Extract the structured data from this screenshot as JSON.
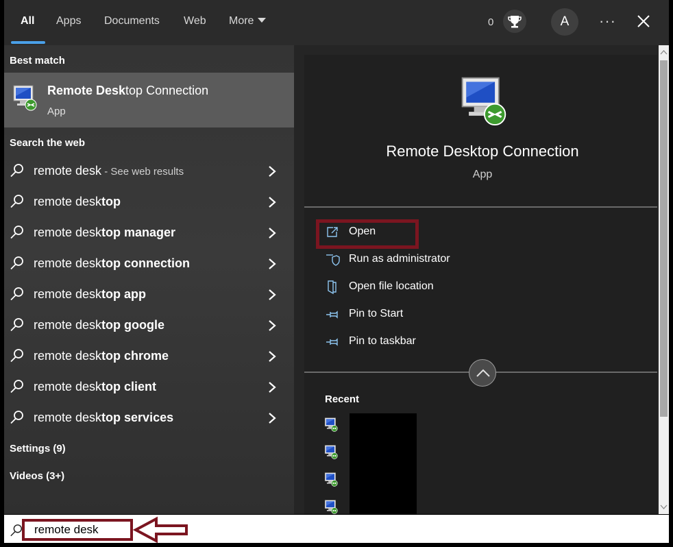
{
  "tabs": [
    {
      "label": "All"
    },
    {
      "label": "Apps"
    },
    {
      "label": "Documents"
    },
    {
      "label": "Web"
    },
    {
      "label": "More"
    }
  ],
  "header": {
    "points": "0",
    "avatar_initial": "A",
    "more_options": "···"
  },
  "left": {
    "best_match_heading": "Best match",
    "best_match": {
      "title_bold": "Remote Desk",
      "title_rest": "top Connection",
      "type": "App"
    },
    "search_web_heading": "Search the web",
    "suggestions": [
      {
        "prefix": "remote desk",
        "bold": "",
        "hint": " - See web results"
      },
      {
        "prefix": "remote desk",
        "bold": "top",
        "hint": ""
      },
      {
        "prefix": "remote desk",
        "bold": "top manager",
        "hint": ""
      },
      {
        "prefix": "remote desk",
        "bold": "top connection",
        "hint": ""
      },
      {
        "prefix": "remote desk",
        "bold": "top app",
        "hint": ""
      },
      {
        "prefix": "remote desk",
        "bold": "top google",
        "hint": ""
      },
      {
        "prefix": "remote desk",
        "bold": "top chrome",
        "hint": ""
      },
      {
        "prefix": "remote desk",
        "bold": "top client",
        "hint": ""
      },
      {
        "prefix": "remote desk",
        "bold": "top services",
        "hint": ""
      }
    ],
    "settings_heading": "Settings (9)",
    "videos_heading": "Videos (3+)"
  },
  "right": {
    "app_title": "Remote Desktop Connection",
    "app_type": "App",
    "actions": [
      {
        "label": "Open",
        "icon": "open-icon"
      },
      {
        "label": "Run as administrator",
        "icon": "shield-icon"
      },
      {
        "label": "Open file location",
        "icon": "folder-icon"
      },
      {
        "label": "Pin to Start",
        "icon": "pin-icon"
      },
      {
        "label": "Pin to taskbar",
        "icon": "pin-icon"
      }
    ],
    "recent_heading": "Recent"
  },
  "search": {
    "value": "remote desk"
  },
  "colors": {
    "accent": "#4aa0e8",
    "annotation": "#7b1520"
  }
}
